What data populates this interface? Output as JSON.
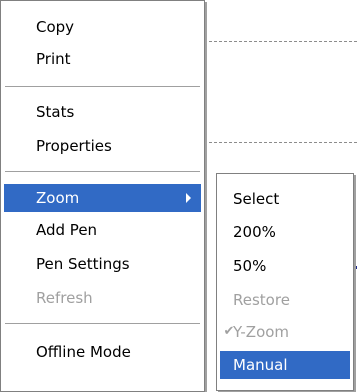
{
  "main_menu": {
    "items": [
      {
        "label": "Copy"
      },
      {
        "label": "Print"
      },
      {
        "label": "Stats"
      },
      {
        "label": "Properties"
      },
      {
        "label": "Zoom"
      },
      {
        "label": "Add Pen"
      },
      {
        "label": "Pen Settings"
      },
      {
        "label": "Refresh"
      },
      {
        "label": "Offline Mode"
      }
    ]
  },
  "zoom_submenu": {
    "items": [
      {
        "label": "Select"
      },
      {
        "label": "200%"
      },
      {
        "label": "50%"
      },
      {
        "label": "Restore"
      },
      {
        "label": "Y-Zoom"
      },
      {
        "label": "Manual"
      }
    ],
    "check_mark": "✔"
  },
  "colors": {
    "highlight": "#316ac5",
    "disabled_text": "#a0a0a0"
  }
}
